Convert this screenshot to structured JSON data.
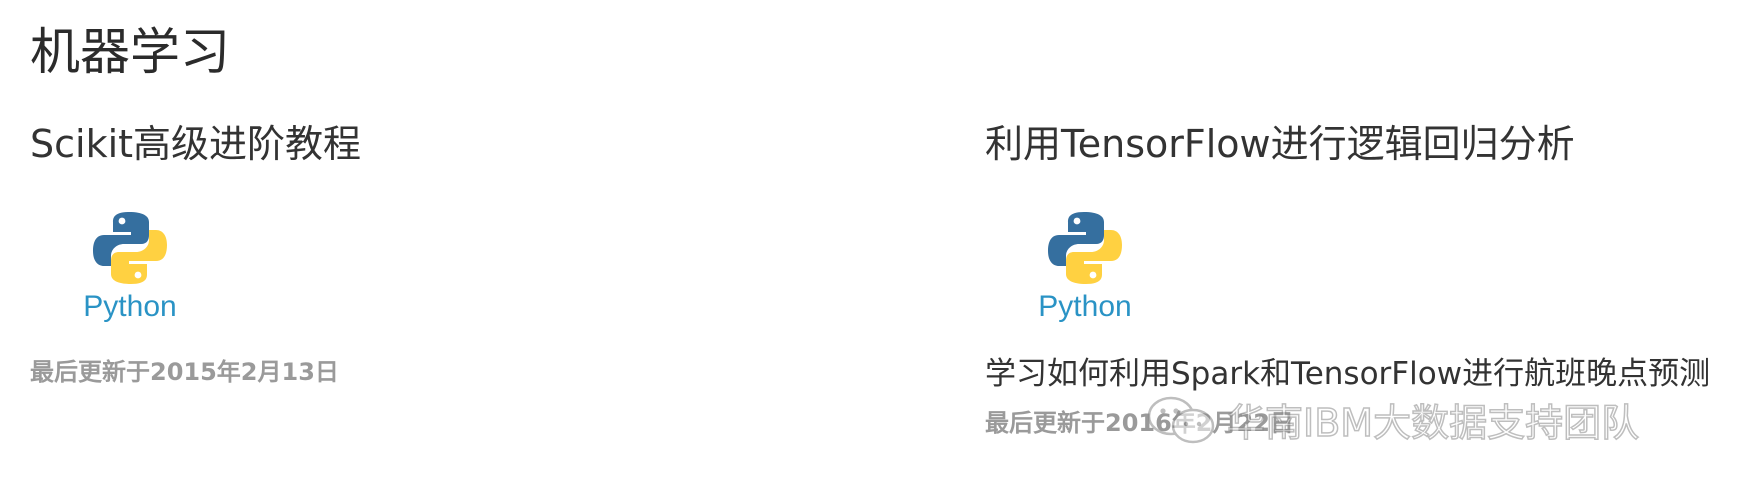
{
  "section": {
    "title": "机器学习"
  },
  "cards": [
    {
      "title": "Scikit高级进阶教程",
      "logo_text": "Python",
      "updated": "最后更新于2015年2月13日"
    },
    {
      "title": "利用TensorFlow进行逻辑回归分析",
      "logo_text": "Python",
      "description": "学习如何利用Spark和TensorFlow进行航班晚点预测",
      "updated": "最后更新于2016年2月22日"
    }
  ],
  "watermark": {
    "text": "华南IBM大数据支持团队",
    "icon": "wechat-icon"
  },
  "colors": {
    "python_blue": "#356f9f",
    "python_yellow": "#ffd141",
    "python_text": "#2a93c5",
    "muted_text": "#9a9a9a"
  }
}
